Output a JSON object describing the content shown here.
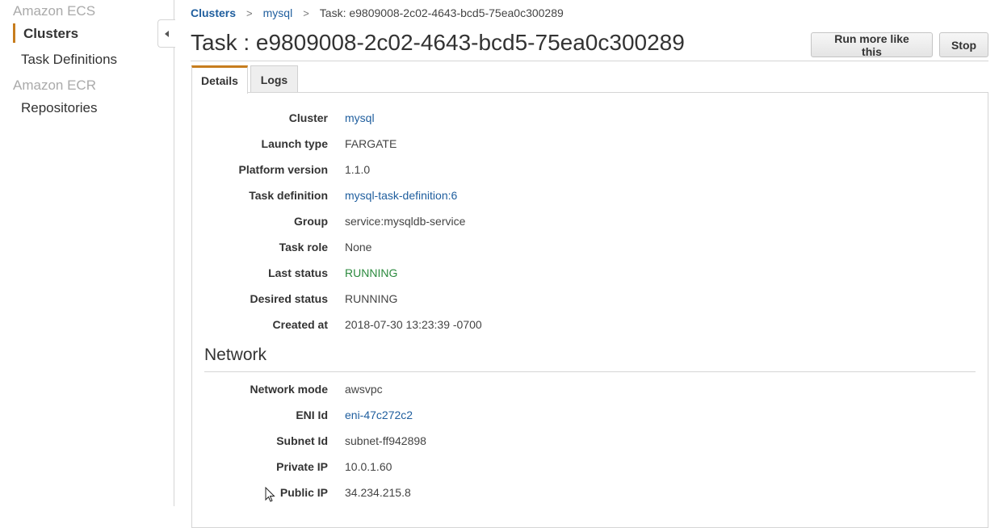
{
  "sidebar": {
    "sections": [
      {
        "title": "Amazon ECS",
        "items": [
          {
            "label": "Clusters",
            "active": true
          },
          {
            "label": "Task Definitions",
            "active": false
          }
        ]
      },
      {
        "title": "Amazon ECR",
        "items": [
          {
            "label": "Repositories",
            "active": false
          }
        ]
      }
    ],
    "accent_color": "#c77d1e"
  },
  "breadcrumb": {
    "items": [
      "Clusters",
      "mysql",
      "Task: e9809008-2c02-4643-bcd5-75ea0c300289"
    ],
    "separator": ">"
  },
  "header": {
    "title": "Task : e9809008-2c02-4643-bcd5-75ea0c300289",
    "buttons": {
      "run_more": "Run more like this",
      "stop": "Stop"
    }
  },
  "tabs": [
    {
      "label": "Details",
      "active": true
    },
    {
      "label": "Logs",
      "active": false
    }
  ],
  "details": [
    {
      "label": "Cluster",
      "value": "mysql",
      "type": "link"
    },
    {
      "label": "Launch type",
      "value": "FARGATE",
      "type": "text"
    },
    {
      "label": "Platform version",
      "value": "1.1.0",
      "type": "text"
    },
    {
      "label": "Task definition",
      "value": "mysql-task-definition:6",
      "type": "link"
    },
    {
      "label": "Group",
      "value": "service:mysqldb-service",
      "type": "text"
    },
    {
      "label": "Task role",
      "value": "None",
      "type": "text"
    },
    {
      "label": "Last status",
      "value": "RUNNING",
      "type": "status"
    },
    {
      "label": "Desired status",
      "value": "RUNNING",
      "type": "text"
    },
    {
      "label": "Created at",
      "value": "2018-07-30 13:23:39 -0700",
      "type": "text"
    }
  ],
  "network": {
    "title": "Network",
    "rows": [
      {
        "label": "Network mode",
        "value": "awsvpc",
        "type": "text"
      },
      {
        "label": "ENI Id",
        "value": "eni-47c272c2",
        "type": "link"
      },
      {
        "label": "Subnet Id",
        "value": "subnet-ff942898",
        "type": "text"
      },
      {
        "label": "Private IP",
        "value": "10.0.1.60",
        "type": "text"
      },
      {
        "label": "Public IP",
        "value": "34.234.215.8",
        "type": "text"
      }
    ]
  },
  "colors": {
    "link": "#1f5e9e",
    "status_running": "#2b8a3e",
    "accent": "#c77d1e"
  }
}
